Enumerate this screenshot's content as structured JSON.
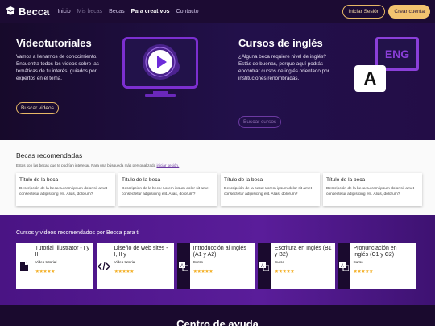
{
  "nav": {
    "logo_text": "Becca",
    "links": [
      "Inicio",
      "Mis becas",
      "Becas",
      "Para creativos",
      "Contacto"
    ],
    "login_label": "Iniciar Sesión",
    "signup_label": "Crear cuenta"
  },
  "hero": {
    "video": {
      "title": "Videotutoriales",
      "text": "Vamos a llenarnos de conocimiento. Encuentra todos los videos sobre las temáticas de tu interés, guiados por expertos en el tema.",
      "button": "Buscar videos"
    },
    "english": {
      "title": "Cursos de inglés",
      "text": "¿Alguna beca requiere nivel de inglés? Estás de buenas, porque aquí podrás encontrar cursos de inglés orientado por instituciones renombradas.",
      "button": "Buscar cursos",
      "eng_badge": "ENG",
      "a_badge": "A"
    }
  },
  "becas": {
    "title": "Becas recomendadas",
    "subtitle": "Estas son las becas que te podrían interesar. Para una búsqueda más personalizada",
    "subtitle_link": "iniciar sesión.",
    "cards": [
      {
        "title": "Título de la beca",
        "desc": "Descripción de la beca: Lorem ipsum dolor sit amet consectetur adipisicing elit. Alias, dolorum?"
      },
      {
        "title": "Título de la beca",
        "desc": "Descripción de la beca: Lorem ipsum dolor sit amet consectetur adipisicing elit. Alias, dolorum?"
      },
      {
        "title": "Título de la beca",
        "desc": "Descripción de la beca: Lorem ipsum dolor sit amet consectetur adipisicing elit. Alias, dolorum?"
      },
      {
        "title": "Título de la beca",
        "desc": "Descripción de la beca: Lorem ipsum dolor sit amet consectetur adipisicing elit. Alias, dolorum?"
      }
    ]
  },
  "cursos": {
    "title": "Cursos y videos recomendados por Becca para ti",
    "items": [
      {
        "title": "Tutorial Illustrator - I y II",
        "type": "Video tutorial",
        "icon": "document-icon",
        "stars": "★★★★★"
      },
      {
        "title": "Diseño de web sites - I, II y",
        "type": "Video tutorial",
        "icon": "code-icon",
        "stars": "★★★★★"
      },
      {
        "title": "Introducción al Inglés (A1 y A2)",
        "type": "Curso",
        "icon": "translate-icon",
        "stars": "★★★★★"
      },
      {
        "title": "Escritura en Inglés (B1 y B2)",
        "type": "Curso",
        "icon": "translate-icon",
        "stars": "★★★★★"
      },
      {
        "title": "Pronunciación en Inglés (C1 y C2)",
        "type": "Curso",
        "icon": "translate-icon",
        "stars": "★★★★★"
      }
    ]
  },
  "footer": {
    "title": "Centro de ayuda"
  },
  "colors": {
    "brand_purple": "#6c2bd9",
    "accent_gold": "#f3c36f",
    "dark_bg": "#1a0a2e"
  }
}
